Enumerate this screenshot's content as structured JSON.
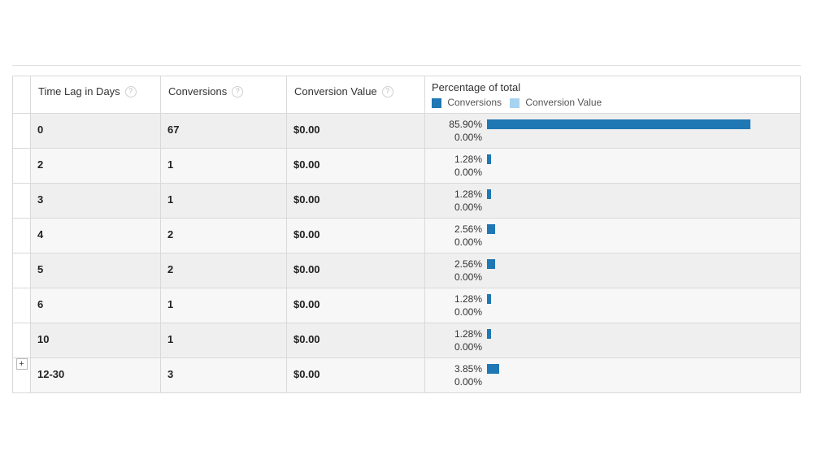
{
  "colors": {
    "conversions": "#1f77b4",
    "conversion_value": "#a6d3ef"
  },
  "headers": {
    "time_lag": "Time Lag in Days",
    "conversions": "Conversions",
    "conversion_value": "Conversion Value",
    "pct_title": "Percentage of total",
    "legend_conv": "Conversions",
    "legend_val": "Conversion Value"
  },
  "help_icon_label": "?",
  "expand_icon_label": "+",
  "rows": [
    {
      "time_lag": "0",
      "conversions": "67",
      "value": "$0.00",
      "pct_conv": "85.90%",
      "pct_conv_num": 85.9,
      "pct_val": "0.00%",
      "pct_val_num": 0.0,
      "expandable": false
    },
    {
      "time_lag": "2",
      "conversions": "1",
      "value": "$0.00",
      "pct_conv": "1.28%",
      "pct_conv_num": 1.28,
      "pct_val": "0.00%",
      "pct_val_num": 0.0,
      "expandable": false
    },
    {
      "time_lag": "3",
      "conversions": "1",
      "value": "$0.00",
      "pct_conv": "1.28%",
      "pct_conv_num": 1.28,
      "pct_val": "0.00%",
      "pct_val_num": 0.0,
      "expandable": false
    },
    {
      "time_lag": "4",
      "conversions": "2",
      "value": "$0.00",
      "pct_conv": "2.56%",
      "pct_conv_num": 2.56,
      "pct_val": "0.00%",
      "pct_val_num": 0.0,
      "expandable": false
    },
    {
      "time_lag": "5",
      "conversions": "2",
      "value": "$0.00",
      "pct_conv": "2.56%",
      "pct_conv_num": 2.56,
      "pct_val": "0.00%",
      "pct_val_num": 0.0,
      "expandable": false
    },
    {
      "time_lag": "6",
      "conversions": "1",
      "value": "$0.00",
      "pct_conv": "1.28%",
      "pct_conv_num": 1.28,
      "pct_val": "0.00%",
      "pct_val_num": 0.0,
      "expandable": false
    },
    {
      "time_lag": "10",
      "conversions": "1",
      "value": "$0.00",
      "pct_conv": "1.28%",
      "pct_conv_num": 1.28,
      "pct_val": "0.00%",
      "pct_val_num": 0.0,
      "expandable": false
    },
    {
      "time_lag": "12-30",
      "conversions": "3",
      "value": "$0.00",
      "pct_conv": "3.85%",
      "pct_conv_num": 3.85,
      "pct_val": "0.00%",
      "pct_val_num": 0.0,
      "expandable": true
    }
  ],
  "chart_data": {
    "type": "bar",
    "categories": [
      "0",
      "2",
      "3",
      "4",
      "5",
      "6",
      "10",
      "12-30"
    ],
    "series": [
      {
        "name": "Conversions (% of total)",
        "values": [
          85.9,
          1.28,
          1.28,
          2.56,
          2.56,
          1.28,
          1.28,
          3.85
        ]
      },
      {
        "name": "Conversion Value (% of total)",
        "values": [
          0.0,
          0.0,
          0.0,
          0.0,
          0.0,
          0.0,
          0.0,
          0.0
        ]
      }
    ],
    "title": "Percentage of total",
    "xlabel": "Time Lag in Days",
    "ylabel": "",
    "ylim": [
      0,
      100
    ]
  }
}
